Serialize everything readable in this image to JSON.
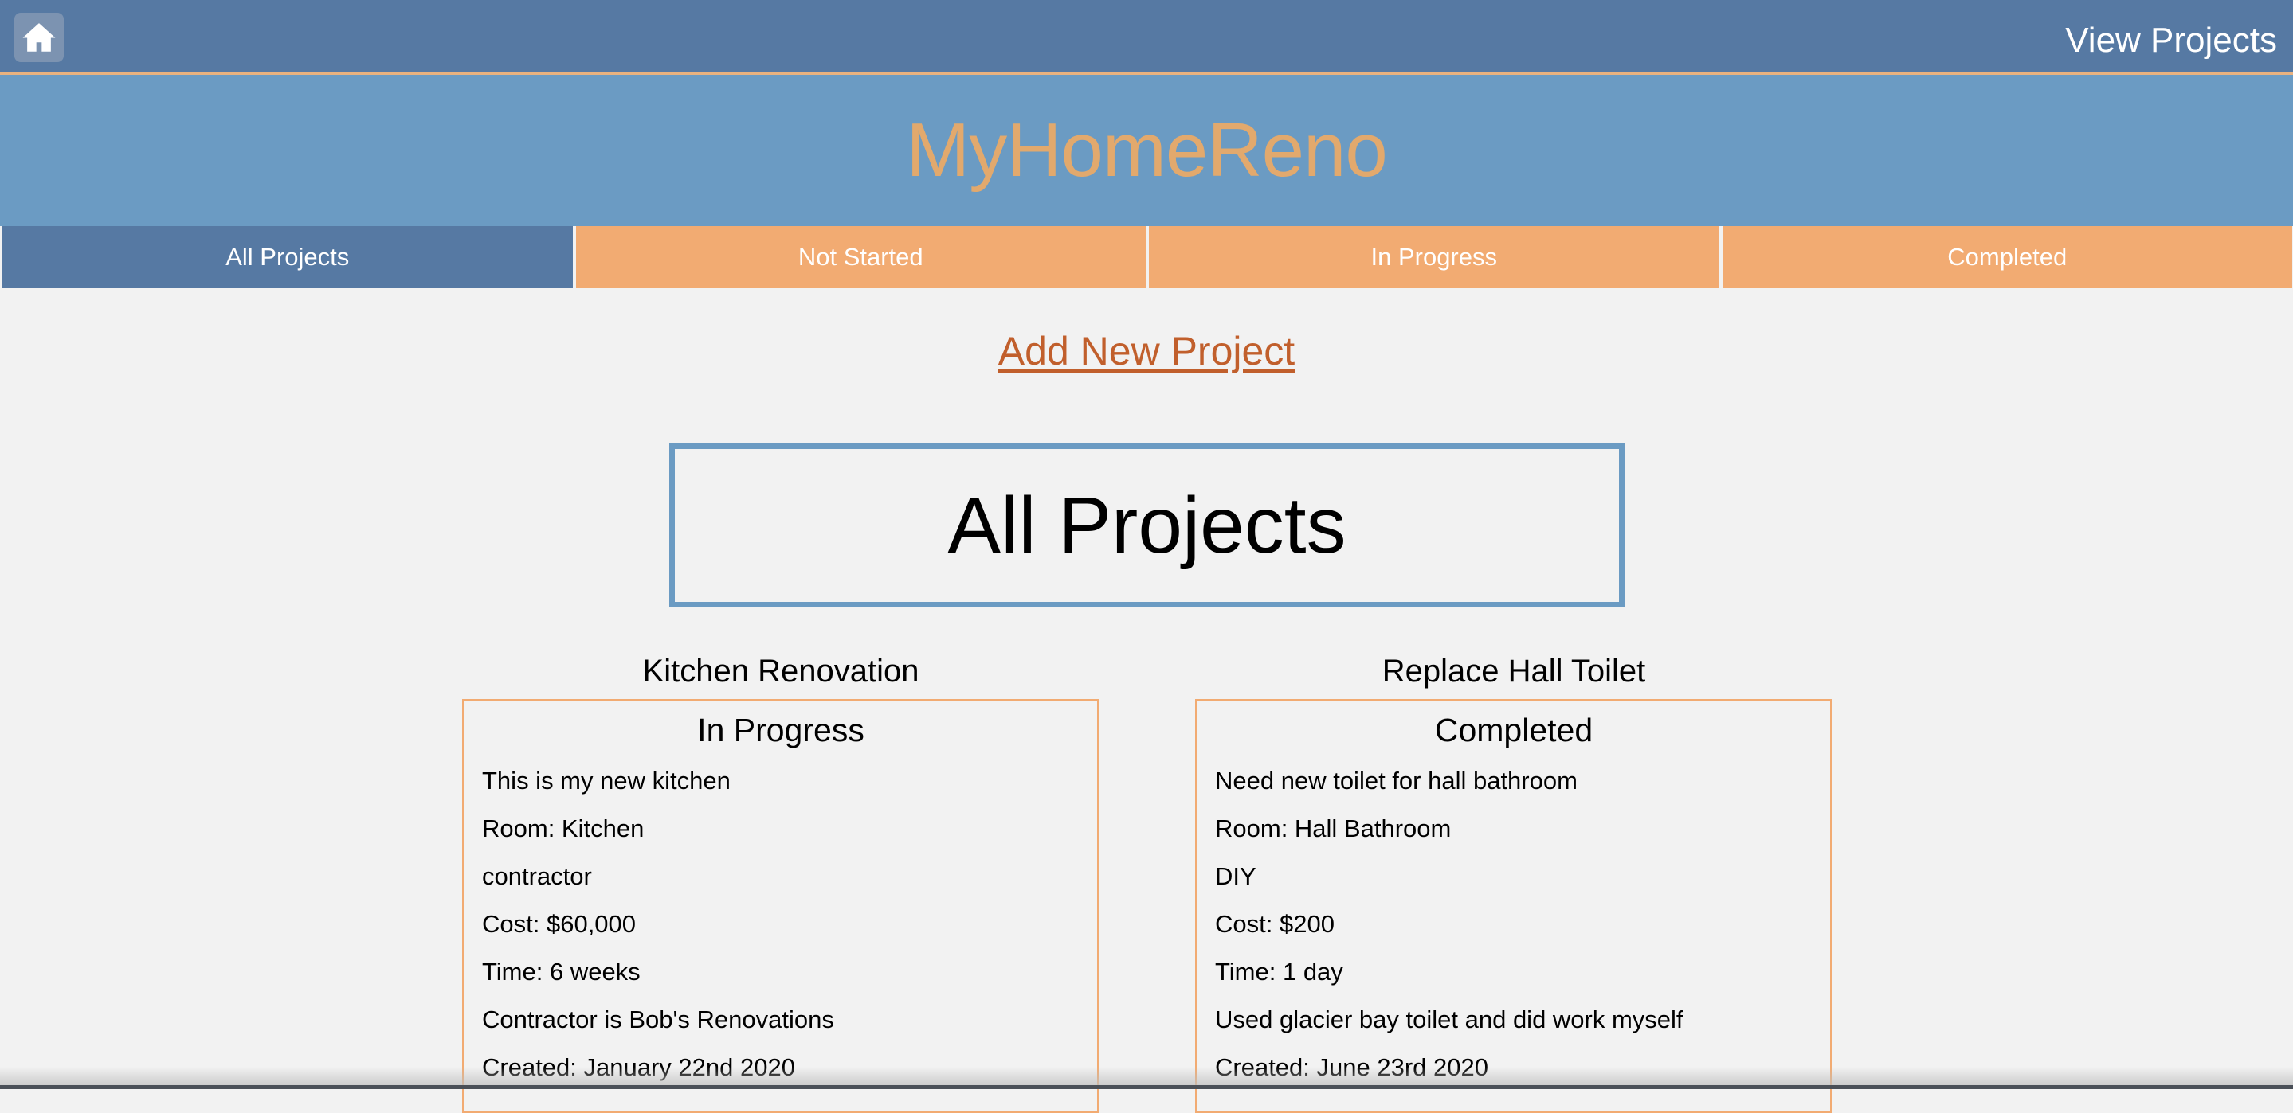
{
  "topbar": {
    "home_icon": "home-icon",
    "view_projects_label": "View Projects"
  },
  "banner": {
    "brand": "MyHomeReno"
  },
  "tabs": [
    {
      "label": "All Projects",
      "active": true
    },
    {
      "label": "Not Started",
      "active": false
    },
    {
      "label": "In Progress",
      "active": false
    },
    {
      "label": "Completed",
      "active": false
    }
  ],
  "add_project_label": "Add New Project",
  "page_heading": "All Projects",
  "projects": [
    {
      "title": "Kitchen Renovation",
      "status": "In Progress",
      "description": "This is my new kitchen",
      "room": "Room: Kitchen",
      "worker": "contractor",
      "cost": "Cost: $60,000",
      "time": "Time: 6 weeks",
      "notes": "Contractor is Bob's Renovations",
      "created": "Created: January 22nd 2020"
    },
    {
      "title": "Replace Hall Toilet",
      "status": "Completed",
      "description": "Need new toilet for hall bathroom",
      "room": "Room: Hall Bathroom",
      "worker": "DIY",
      "cost": "Cost: $200",
      "time": "Time: 1 day",
      "notes": "Used glacier bay toilet and did work myself",
      "created": "Created: June 23rd 2020"
    }
  ],
  "colors": {
    "topbar": "#5679a3",
    "banner": "#6b9bc3",
    "brand_text": "#e2a96d",
    "tab_inactive": "#f2ab72",
    "tab_active": "#5679a3",
    "link": "#c15f2c",
    "card_border": "#f2ab72"
  }
}
